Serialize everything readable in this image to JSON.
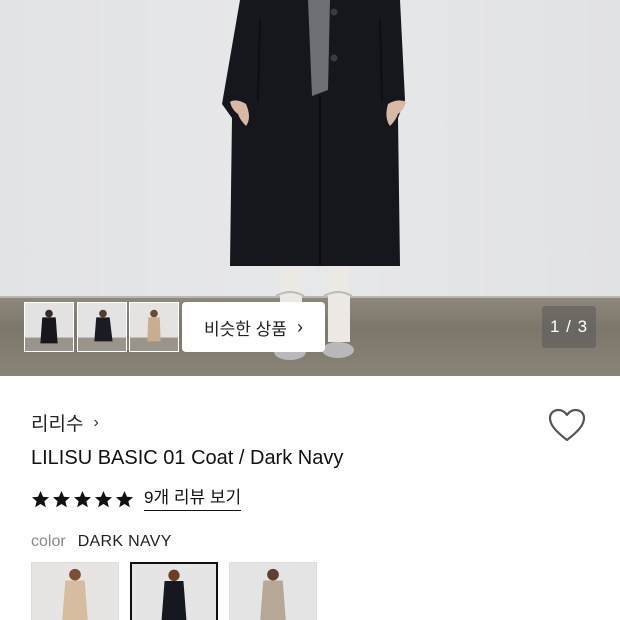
{
  "gallery": {
    "similar_button_label": "비슷한 상품",
    "counter": "1 / 3",
    "thumbnails": [
      {
        "variant": "black-coat"
      },
      {
        "variant": "navy-coat"
      },
      {
        "variant": "beige-coat"
      }
    ]
  },
  "product": {
    "brand": "리리수",
    "title": "LILISU BASIC 01 Coat / Dark Navy",
    "rating_stars": 5,
    "review_link": "9개 리뷰 보기",
    "color_label": "color",
    "color_value": "DARK NAVY",
    "swatches": [
      {
        "variant": "beige",
        "selected": false
      },
      {
        "variant": "dark-navy",
        "selected": true
      },
      {
        "variant": "gray-beige",
        "selected": false
      }
    ]
  },
  "colors": {
    "coat_navy": "#15171d",
    "star": "#111111",
    "heart_stroke": "#555555"
  }
}
